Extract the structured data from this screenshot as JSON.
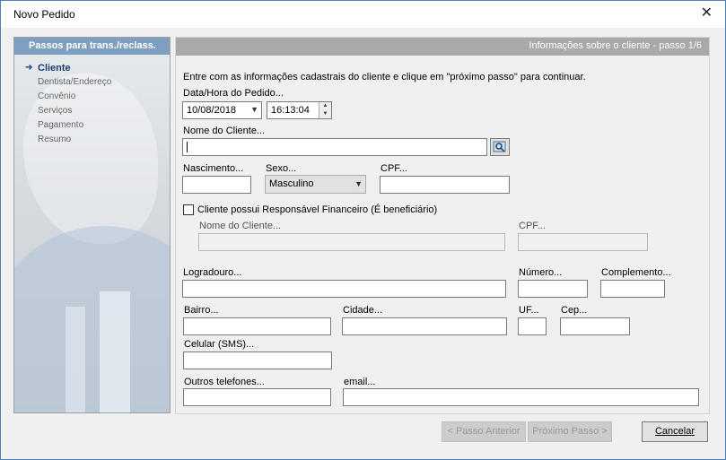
{
  "window": {
    "title": "Novo Pedido",
    "close": "✕"
  },
  "sidebar": {
    "header": "Passos para trans./reclass.",
    "active_marker": "➜",
    "steps": [
      "Cliente",
      "Dentista/Endereço",
      "Convênio",
      "Serviços",
      "Pagamento",
      "Resumo"
    ]
  },
  "main": {
    "header": "Informações sobre o cliente - passo 1/6",
    "intro": "Entre com as informações cadastrais do cliente e clique em \"próximo passo\" para continuar.",
    "datetime": {
      "label": "Data/Hora do Pedido...",
      "date": "10/08/2018",
      "time": "16:13:04"
    },
    "client_name": {
      "label": "Nome do Cliente...",
      "value": ""
    },
    "birth": {
      "label": "Nascimento...",
      "value": ""
    },
    "sex": {
      "label": "Sexo...",
      "value": "Masculino"
    },
    "cpf": {
      "label": "CPF...",
      "value": ""
    },
    "responsible": {
      "checkbox_label": "Cliente possui Responsável Financeiro (É beneficiário)",
      "checked": false,
      "name_label": "Nome do Cliente...",
      "cpf_label": "CPF..."
    },
    "address": {
      "street_label": "Logradouro...",
      "number_label": "Número...",
      "complement_label": "Complemento...",
      "district_label": "Bairro...",
      "city_label": "Cidade...",
      "state_label": "UF...",
      "zip_label": "Cep..."
    },
    "contact": {
      "mobile_label": "Celular (SMS)...",
      "other_phones_label": "Outros telefones...",
      "email_label": "email..."
    }
  },
  "footer": {
    "prev": "< Passo Anterior",
    "next": "Próximo Passo >",
    "cancel": "Cancelar"
  },
  "icons": {
    "dropdown": "chevron-down-icon",
    "spin": "spinner-icon",
    "search": "search-icon"
  }
}
